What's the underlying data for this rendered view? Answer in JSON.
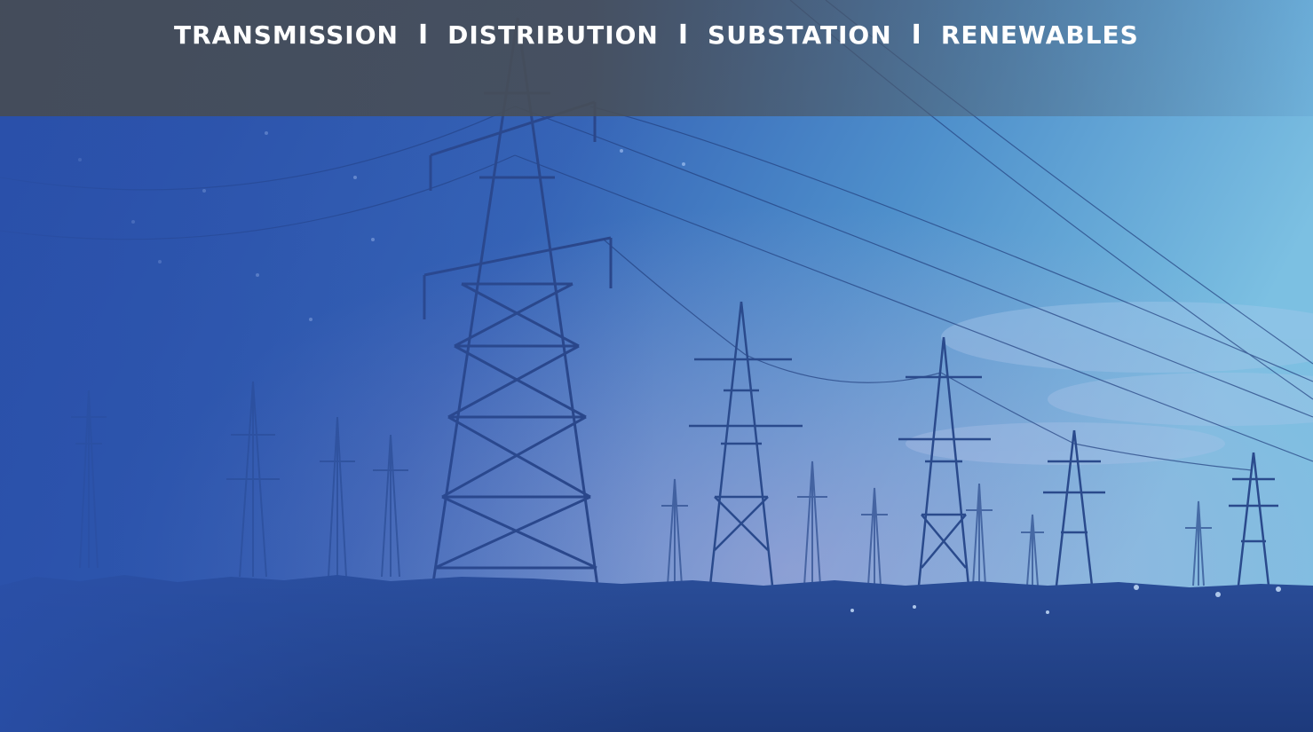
{
  "nav": {
    "items": [
      {
        "label": "TRANSMISSION"
      },
      {
        "label": "DISTRIBUTION"
      },
      {
        "label": "SUBSTATION"
      },
      {
        "label": "RENEWABLES"
      }
    ],
    "separator": "I"
  },
  "hero": {
    "scene": "power-transmission-towers-at-dusk"
  },
  "colors": {
    "band": "#464c54",
    "sky_left": "#2a52ab",
    "sky_right": "#6cb2da",
    "nav_text": "#ffffff"
  }
}
